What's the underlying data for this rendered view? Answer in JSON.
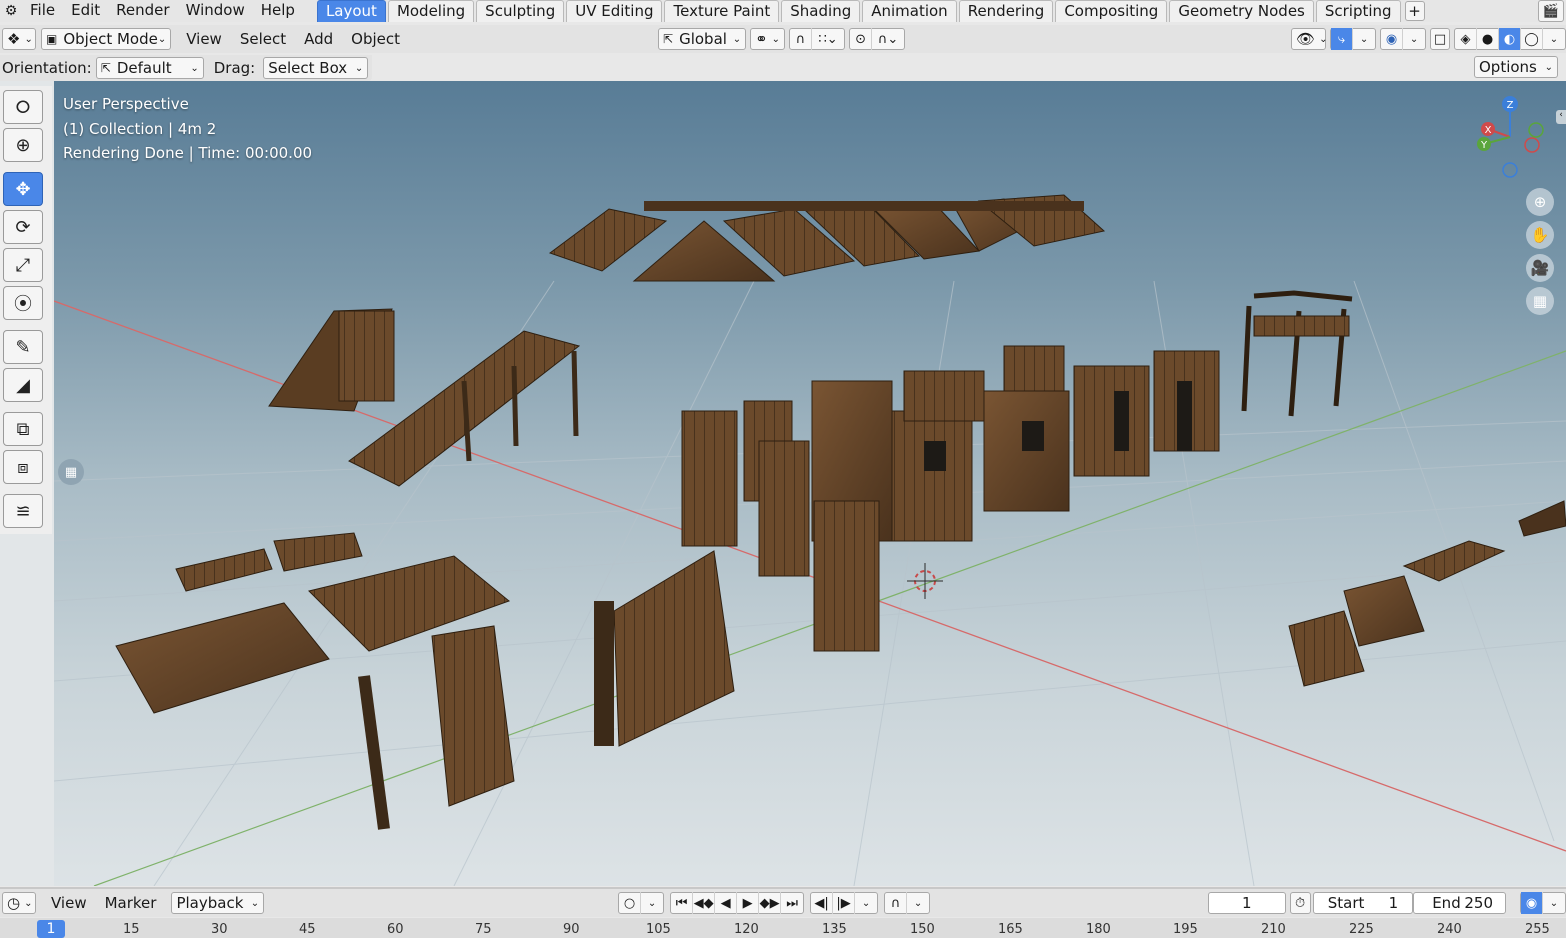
{
  "menu": {
    "items": [
      "File",
      "Edit",
      "Render",
      "Window",
      "Help"
    ]
  },
  "workspaces": {
    "tabs": [
      "Layout",
      "Modeling",
      "Sculpting",
      "UV Editing",
      "Texture Paint",
      "Shading",
      "Animation",
      "Rendering",
      "Compositing",
      "Geometry Nodes",
      "Scripting"
    ],
    "active": "Layout",
    "add_label": "+"
  },
  "header": {
    "mode": "Object Mode",
    "menus": [
      "View",
      "Select",
      "Add",
      "Object"
    ],
    "transform_orientation": "Global"
  },
  "tool_settings": {
    "orientation_label": "Orientation:",
    "orientation_value": "Default",
    "drag_label": "Drag:",
    "drag_value": "Select Box",
    "options_label": "Options"
  },
  "viewport": {
    "line1": "User Perspective",
    "line2": "(1) Collection | 4m 2",
    "line3": "Rendering Done | Time: 00:00.00",
    "gizmo": {
      "z": "Z",
      "x": "X",
      "y": "Y"
    }
  },
  "timeline": {
    "menus": [
      "View",
      "Marker"
    ],
    "playback_label": "Playback",
    "current_frame": "1",
    "start_label": "Start",
    "start_value": "1",
    "end_label": "End",
    "end_value": "250",
    "ruler_current": "1",
    "ruler_ticks": [
      "15",
      "30",
      "45",
      "60",
      "75",
      "90",
      "105",
      "120",
      "135",
      "150",
      "165",
      "180",
      "195",
      "210",
      "225",
      "240",
      "255"
    ]
  },
  "colors": {
    "accent": "#4a87e8",
    "wood": "#6b4a2b",
    "wood_dark": "#3c2a18"
  }
}
